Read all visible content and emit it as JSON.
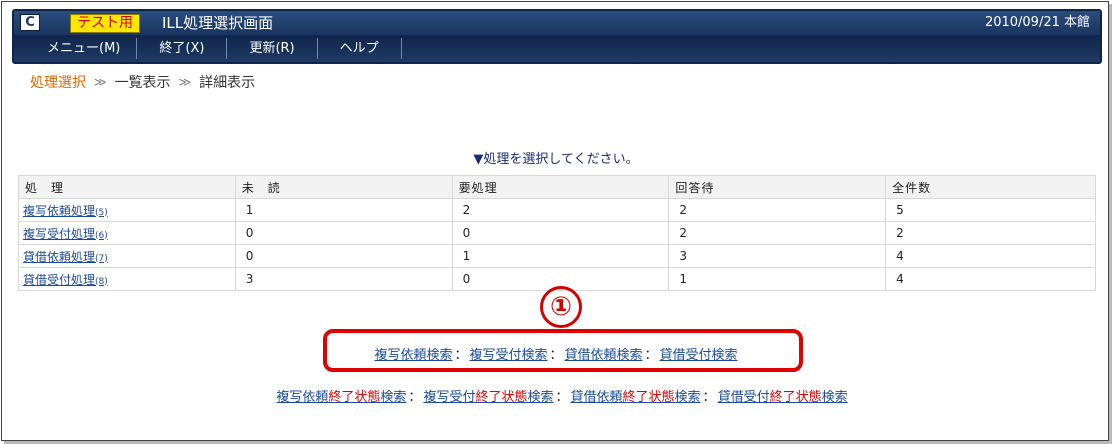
{
  "header": {
    "logo": "C",
    "badge": "テスト用",
    "title": "ILL処理選択画面",
    "date_library": "2010/09/21 本館"
  },
  "menu": [
    {
      "label": "メニュー(M)"
    },
    {
      "label": "終了(X)"
    },
    {
      "label": "更新(R)"
    },
    {
      "label": "ヘルプ"
    }
  ],
  "breadcrumb": {
    "current": "処理選択",
    "separator": "≫",
    "items": [
      "一覧表示",
      "詳細表示"
    ]
  },
  "instruction": "▼処理を選択してください。",
  "table": {
    "headers": [
      "処　理",
      "未　読",
      "要処理",
      "回答待",
      "全件数"
    ],
    "rows": [
      {
        "name": "複写依頼処理",
        "key": "(5)",
        "unread": "1",
        "todo": "2",
        "waiting": "2",
        "total": "5"
      },
      {
        "name": "複写受付処理",
        "key": "(6)",
        "unread": "0",
        "todo": "0",
        "waiting": "2",
        "total": "2"
      },
      {
        "name": "貸借依頼処理",
        "key": "(7)",
        "unread": "0",
        "todo": "1",
        "waiting": "3",
        "total": "4"
      },
      {
        "name": "貸借受付処理",
        "key": "(8)",
        "unread": "3",
        "todo": "0",
        "waiting": "1",
        "total": "4"
      }
    ]
  },
  "callout": {
    "number": "①"
  },
  "search_links": {
    "separator": "：",
    "items": [
      "複写依頼検索",
      "複写受付検索",
      "貸借依頼検索",
      "貸借受付検索"
    ]
  },
  "closed_search_links": {
    "separator": "：",
    "items": [
      {
        "prefix": "複写依頼",
        "highlight": "終了状態",
        "suffix": "検索"
      },
      {
        "prefix": "複写受付",
        "highlight": "終了状態",
        "suffix": "検索"
      },
      {
        "prefix": "貸借依頼",
        "highlight": "終了状態",
        "suffix": "検索"
      },
      {
        "prefix": "貸借受付",
        "highlight": "終了状態",
        "suffix": "検索"
      }
    ]
  },
  "colors": {
    "header_bg": "#1d3a64",
    "badge_bg": "#ffe600",
    "badge_text": "#d40000",
    "link": "#1a4a9a",
    "highlight_red": "#e00000",
    "breadcrumb_current": "#e06a00"
  }
}
